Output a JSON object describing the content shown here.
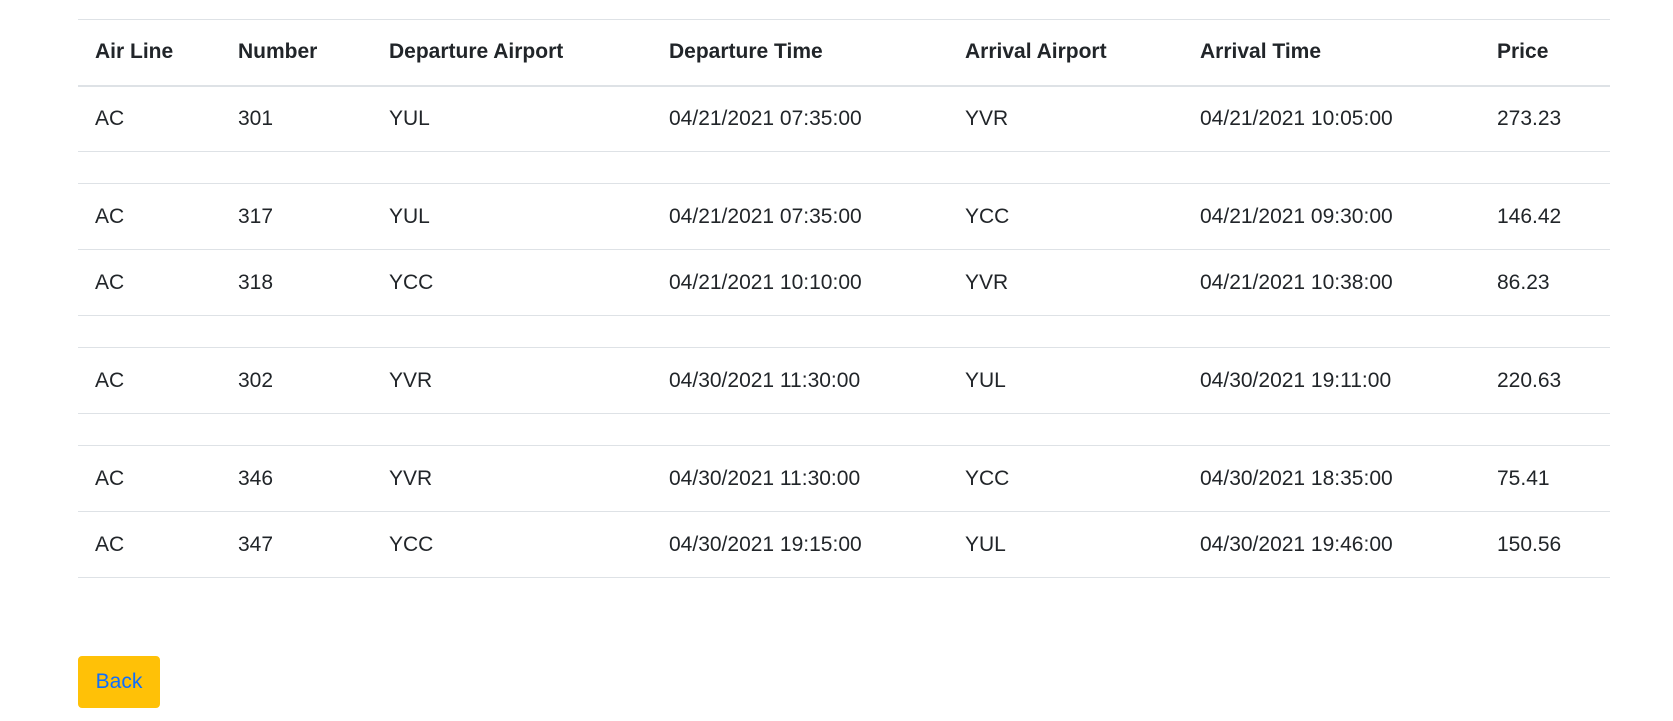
{
  "table": {
    "headers": [
      "Air Line",
      "Number",
      "Departure Airport",
      "Departure Time",
      "Arrival Airport",
      "Arrival Time",
      "Price"
    ],
    "rows": [
      {
        "type": "data",
        "cells": [
          "AC",
          "301",
          "YUL",
          "04/21/2021 07:35:00",
          "YVR",
          "04/21/2021 10:05:00",
          "273.23"
        ]
      },
      {
        "type": "spacer"
      },
      {
        "type": "data",
        "cells": [
          "AC",
          "317",
          "YUL",
          "04/21/2021 07:35:00",
          "YCC",
          "04/21/2021 09:30:00",
          "146.42"
        ]
      },
      {
        "type": "data",
        "cells": [
          "AC",
          "318",
          "YCC",
          "04/21/2021 10:10:00",
          "YVR",
          "04/21/2021 10:38:00",
          "86.23"
        ]
      },
      {
        "type": "spacer"
      },
      {
        "type": "data",
        "cells": [
          "AC",
          "302",
          "YVR",
          "04/30/2021 11:30:00",
          "YUL",
          "04/30/2021 19:11:00",
          "220.63"
        ]
      },
      {
        "type": "spacer"
      },
      {
        "type": "data",
        "cells": [
          "AC",
          "346",
          "YVR",
          "04/30/2021 11:30:00",
          "YCC",
          "04/30/2021 18:35:00",
          "75.41"
        ]
      },
      {
        "type": "data",
        "cells": [
          "AC",
          "347",
          "YCC",
          "04/30/2021 19:15:00",
          "YUL",
          "04/30/2021 19:46:00",
          "150.56"
        ]
      }
    ]
  },
  "back_button": {
    "label": "Back"
  },
  "colors": {
    "button_bg": "#ffc107",
    "button_text": "#0d6efd",
    "border": "#dee2e6",
    "text": "#212529"
  }
}
